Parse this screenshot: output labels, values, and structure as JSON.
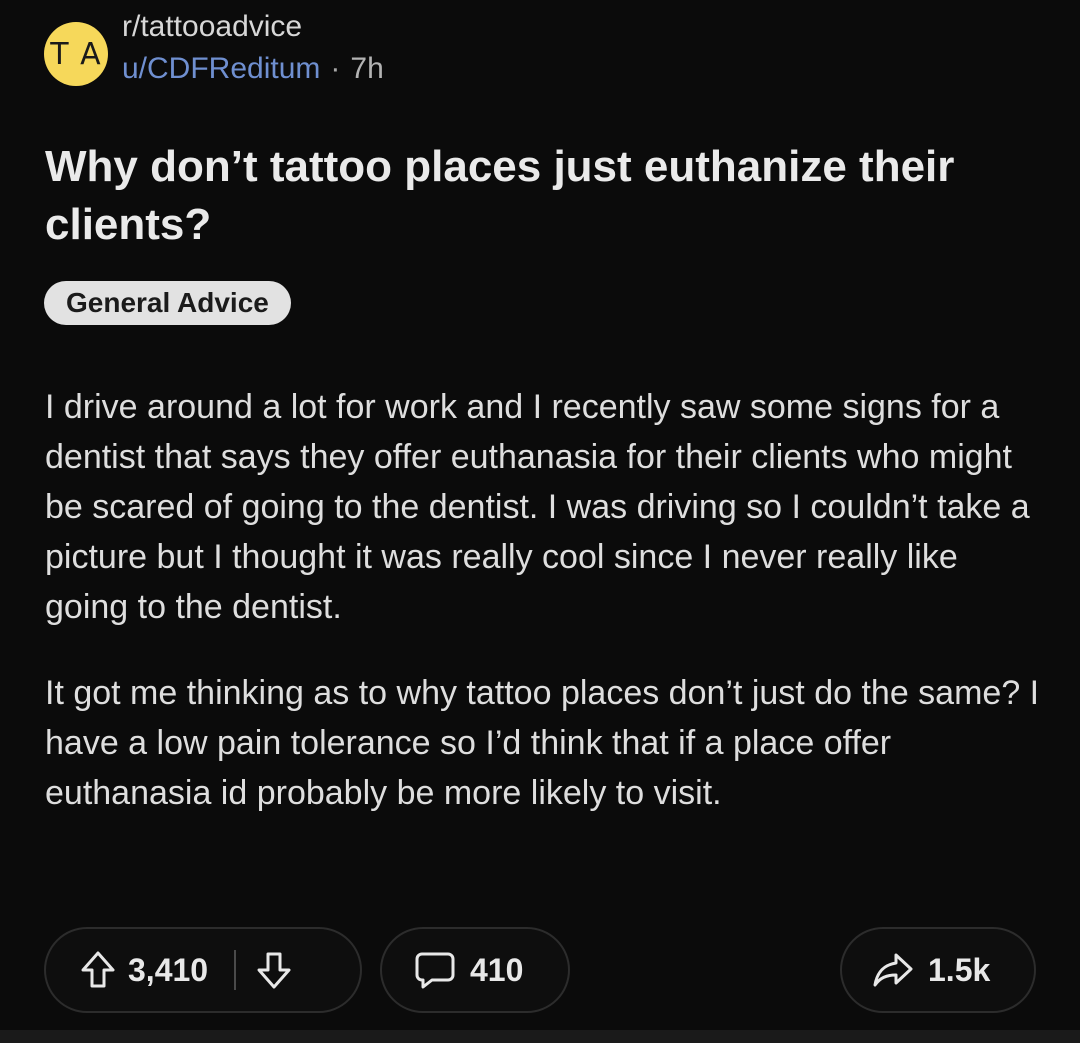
{
  "header": {
    "avatar_text": "T A",
    "subreddit": "r/tattooadvice",
    "username": "u/CDFReditum",
    "separator": "·",
    "age": "7h",
    "avatar_color": "#f6d85a",
    "username_color": "#6f8fd0"
  },
  "post": {
    "title": "Why don’t tattoo places just euthanize their clients?",
    "flair": "General Advice",
    "paragraphs": [
      "I drive around a lot for work and I recently saw some signs for a dentist that says they offer euthanasia for their clients who might be scared of going to the dentist. I was driving so I couldn’t take a picture but I thought it was really cool since I never really like going to the dentist.",
      "It got me thinking as to why tattoo places don’t just do the same? I have a low pain tolerance so I’d think that if a place offer euthanasia id probably be more likely to visit."
    ]
  },
  "actions": {
    "upvote_icon": "arrow-up-icon",
    "vote_count": "3,410",
    "downvote_icon": "arrow-down-icon",
    "comment_icon": "speech-bubble-icon",
    "comment_count": "410",
    "share_icon": "share-arrow-icon",
    "share_count": "1.5k"
  }
}
